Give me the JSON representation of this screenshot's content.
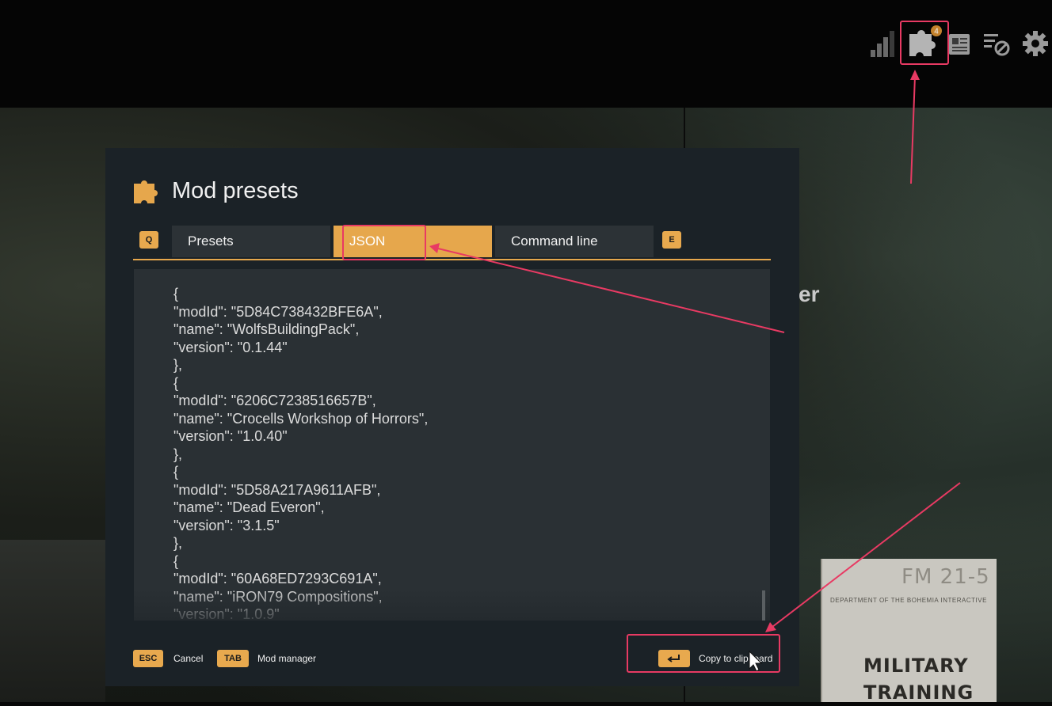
{
  "modal": {
    "title": "Mod presets",
    "tabs": [
      {
        "label": "Presets",
        "active": false
      },
      {
        "label": "JSON",
        "active": true
      },
      {
        "label": "Command line",
        "active": false
      }
    ],
    "prev_tab_key": "Q",
    "next_tab_key": "E",
    "json_lines": [
      "{",
      "\"modId\": \"5D84C738432BFE6A\",",
      "\"name\": \"WolfsBuildingPack\",",
      "\"version\": \"0.1.44\"",
      "},",
      "{",
      "\"modId\": \"6206C7238516657B\",",
      "\"name\": \"Crocells Workshop of Horrors\",",
      "\"version\": \"1.0.40\"",
      "},",
      "{",
      "\"modId\": \"5D58A217A9611AFB\",",
      "\"name\": \"Dead Everon\",",
      "\"version\": \"3.1.5\"",
      "},",
      "{",
      "\"modId\": \"60A68ED7293C691A\",",
      "\"name\": \"iRON79 Compositions\",",
      "\"version\": \"1.0.9\""
    ],
    "footer": {
      "cancel_key": "ESC",
      "cancel_label": "Cancel",
      "mod_manager_key": "TAB",
      "mod_manager_label": "Mod manager",
      "copy_key_icon": "enter-icon",
      "copy_label": "Copy to clipboard"
    }
  },
  "topbar": {
    "mods_badge": "4",
    "icons": [
      "signal-bars-icon",
      "puzzle-icon",
      "news-icon",
      "filter-off-icon",
      "gear-icon"
    ]
  },
  "background": {
    "manual_code": "FM 21-5",
    "manual_department": "DEPARTMENT OF THE BOHEMIA INTERACTIVE",
    "manual_title_1": "MILITARY",
    "manual_title_2": "TRAINING",
    "partial_heading": "er"
  },
  "colors": {
    "accent": "#e6a74c",
    "modal_bg": "#1b2227",
    "panel_bg": "#2a3034",
    "annotation": "#e83a63"
  }
}
